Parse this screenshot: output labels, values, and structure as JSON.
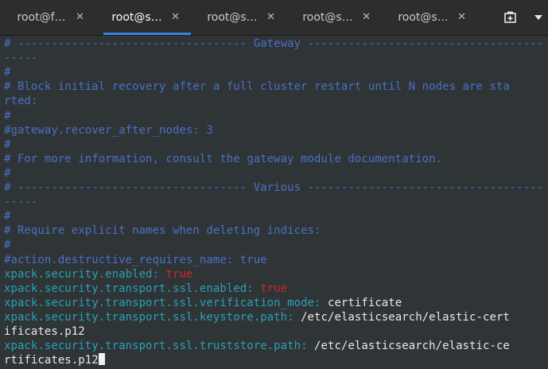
{
  "tabs": [
    {
      "label": "root@f…",
      "close": "✕",
      "active": false
    },
    {
      "label": "root@s…",
      "close": "✕",
      "active": true
    },
    {
      "label": "root@s…",
      "close": "✕",
      "active": false
    },
    {
      "label": "root@s…",
      "close": "✕",
      "active": false
    },
    {
      "label": "root@s…",
      "close": "✕",
      "active": false
    }
  ],
  "actions": {
    "new_tab_icon": "new-tab-icon",
    "dropdown_icon": "chevron-down-icon"
  },
  "colors": {
    "comment": "#4a70c6",
    "key": "#2aa1b3",
    "bool": "#cc2a2a",
    "text": "#e8e8e8",
    "background": "#2f3436",
    "accent": "#3584e4"
  },
  "terminal": {
    "lines": [
      {
        "segments": [
          {
            "cls": "c",
            "text": "# ---------------------------------- Gateway -----------------------------------"
          }
        ]
      },
      {
        "segments": [
          {
            "cls": "c",
            "text": "-----"
          }
        ]
      },
      {
        "segments": [
          {
            "cls": "c",
            "text": "#"
          }
        ]
      },
      {
        "segments": [
          {
            "cls": "c",
            "text": "# Block initial recovery after a full cluster restart until N nodes are sta"
          }
        ]
      },
      {
        "segments": [
          {
            "cls": "c",
            "text": "rted:"
          }
        ]
      },
      {
        "segments": [
          {
            "cls": "c",
            "text": "#"
          }
        ]
      },
      {
        "segments": [
          {
            "cls": "c",
            "text": "#gateway.recover_after_nodes: 3"
          }
        ]
      },
      {
        "segments": [
          {
            "cls": "c",
            "text": "#"
          }
        ]
      },
      {
        "segments": [
          {
            "cls": "c",
            "text": "# For more information, consult the gateway module documentation."
          }
        ]
      },
      {
        "segments": [
          {
            "cls": "c",
            "text": "#"
          }
        ]
      },
      {
        "segments": [
          {
            "cls": "c",
            "text": "# ---------------------------------- Various -----------------------------------"
          }
        ]
      },
      {
        "segments": [
          {
            "cls": "c",
            "text": "-----"
          }
        ]
      },
      {
        "segments": [
          {
            "cls": "c",
            "text": "#"
          }
        ]
      },
      {
        "segments": [
          {
            "cls": "c",
            "text": "# Require explicit names when deleting indices:"
          }
        ]
      },
      {
        "segments": [
          {
            "cls": "c",
            "text": "#"
          }
        ]
      },
      {
        "segments": [
          {
            "cls": "c",
            "text": "#action.destructive_requires_name: true"
          }
        ]
      },
      {
        "segments": [
          {
            "cls": "k",
            "text": "xpack.security.enabled:"
          },
          {
            "cls": "t",
            "text": " true"
          }
        ]
      },
      {
        "segments": [
          {
            "cls": "k",
            "text": "xpack.security.transport.ssl.enabled:"
          },
          {
            "cls": "t",
            "text": " true"
          }
        ]
      },
      {
        "segments": [
          {
            "cls": "k",
            "text": "xpack.security.transport.ssl.verification_mode:"
          },
          {
            "cls": "w",
            "text": " certificate"
          }
        ]
      },
      {
        "segments": [
          {
            "cls": "k",
            "text": "xpack.security.transport.ssl.keystore.path:"
          },
          {
            "cls": "w",
            "text": " /etc/elasticsearch/elastic-cert"
          }
        ]
      },
      {
        "segments": [
          {
            "cls": "w",
            "text": "ificates.p12"
          }
        ]
      },
      {
        "segments": [
          {
            "cls": "k",
            "text": "xpack.security.transport.ssl.truststore.path:"
          },
          {
            "cls": "w",
            "text": " /etc/elasticsearch/elastic-ce"
          }
        ]
      },
      {
        "segments": [
          {
            "cls": "w",
            "text": "rtificates.p12"
          }
        ],
        "cursor": true
      }
    ]
  }
}
